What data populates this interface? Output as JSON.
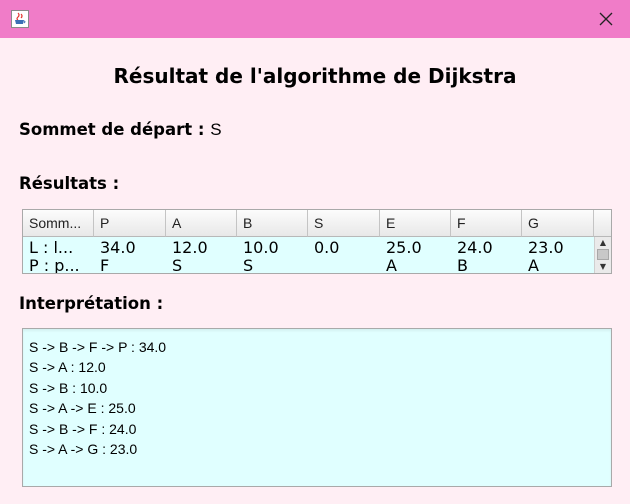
{
  "window": {
    "app_icon": "java-cup-icon",
    "close_icon": "close-icon"
  },
  "heading": "Résultat de l'algorithme de Dijkstra",
  "source": {
    "label": "Sommet de départ :",
    "value": "S"
  },
  "results_label": "Résultats :",
  "table": {
    "headers": [
      "Somm...",
      "P",
      "A",
      "B",
      "S",
      "E",
      "F",
      "G"
    ],
    "rows": [
      [
        "L : l...",
        "34.0",
        "12.0",
        "10.0",
        "0.0",
        "25.0",
        "24.0",
        "23.0"
      ],
      [
        "P : p...",
        "F",
        "S",
        "S",
        "",
        "A",
        "B",
        "A"
      ]
    ]
  },
  "interpretation_label": "Interprétation :",
  "interpretation_lines": [
    "S -> B -> F -> P : 34.0",
    "S -> A : 12.0",
    "S -> B : 10.0",
    "S -> A -> E : 25.0",
    "S -> B -> F : 24.0",
    "S -> A -> G : 23.0"
  ]
}
